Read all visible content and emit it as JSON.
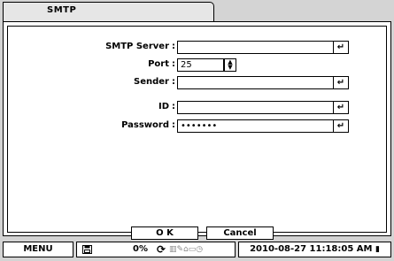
{
  "tab": {
    "label": "SMTP"
  },
  "form": {
    "smtp_server": {
      "label": "SMTP Server",
      "value": "",
      "enter": "↵"
    },
    "port": {
      "label": "Port",
      "value": "25"
    },
    "sender": {
      "label": "Sender",
      "value": "",
      "enter": "↵"
    },
    "id": {
      "label": "ID",
      "value": "",
      "enter": "↵"
    },
    "password": {
      "label": "Password",
      "value": "•••••••",
      "enter": "↵"
    },
    "colon": ":"
  },
  "buttons": {
    "ok": "O K",
    "cancel": "Cancel"
  },
  "statusbar": {
    "menu": "MENU",
    "disk_icon": "floppy-disk-icon",
    "usage": "0%",
    "datetime": "2010-08-27 11:18:05 AM"
  }
}
